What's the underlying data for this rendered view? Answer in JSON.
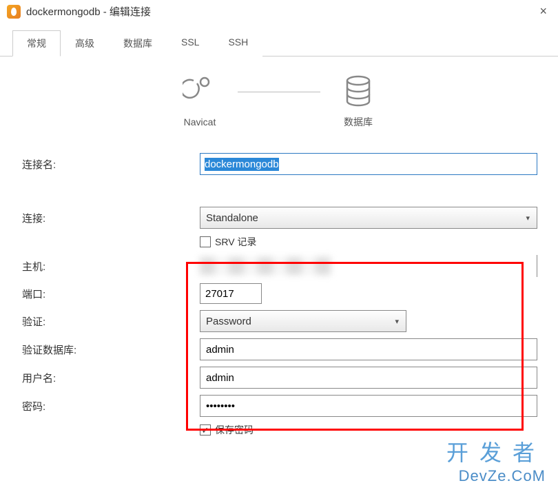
{
  "window": {
    "title": "dockermongodb - 编辑连接",
    "close": "×"
  },
  "tabs": [
    {
      "label": "常规",
      "active": true
    },
    {
      "label": "高级",
      "active": false
    },
    {
      "label": "数据库",
      "active": false
    },
    {
      "label": "SSL",
      "active": false
    },
    {
      "label": "SSH",
      "active": false
    }
  ],
  "diagram": {
    "left": "Navicat",
    "right": "数据库"
  },
  "form": {
    "connection_name": {
      "label": "连接名:",
      "value": "dockermongodb"
    },
    "connection": {
      "label": "连接:",
      "value": "Standalone"
    },
    "srv": {
      "label": "SRV 记录",
      "checked": false
    },
    "host": {
      "label": "主机:"
    },
    "port": {
      "label": "端口:",
      "value": "27017"
    },
    "auth": {
      "label": "验证:",
      "value": "Password"
    },
    "auth_db": {
      "label": "验证数据库:",
      "value": "admin"
    },
    "username": {
      "label": "用户名:",
      "value": "admin"
    },
    "password": {
      "label": "密码:",
      "value": "••••••••"
    },
    "save_password": {
      "label": "保存密码",
      "checked": true
    }
  },
  "watermark": {
    "cn": "开发者",
    "en": "DevZe.CoM"
  }
}
